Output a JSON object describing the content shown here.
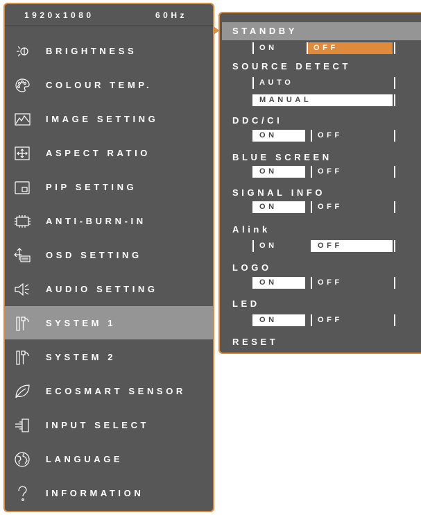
{
  "left_menu": {
    "resolution": "1920x1080",
    "refresh": "60Hz",
    "items": [
      {
        "label": "BRIGHTNESS",
        "icon": "brightness-icon"
      },
      {
        "label": "COLOUR TEMP.",
        "icon": "palette-icon"
      },
      {
        "label": "IMAGE SETTING",
        "icon": "image-icon"
      },
      {
        "label": "ASPECT RATIO",
        "icon": "aspect-ratio-icon"
      },
      {
        "label": "PIP SETTING",
        "icon": "pip-icon"
      },
      {
        "label": "ANTI-BURN-IN",
        "icon": "chip-icon"
      },
      {
        "label": "OSD SETTING",
        "icon": "osd-icon"
      },
      {
        "label": "AUDIO SETTING",
        "icon": "speaker-icon"
      },
      {
        "label": "SYSTEM 1",
        "icon": "tools-icon",
        "selected": true
      },
      {
        "label": "SYSTEM 2",
        "icon": "tools-icon"
      },
      {
        "label": "ECOSMART SENSOR",
        "icon": "leaf-icon"
      },
      {
        "label": "INPUT SELECT",
        "icon": "input-icon"
      },
      {
        "label": "LANGUAGE",
        "icon": "globe-icon"
      },
      {
        "label": "INFORMATION",
        "icon": "question-icon"
      }
    ]
  },
  "right_menu": {
    "standby": {
      "label": "STANDBY",
      "on": "ON",
      "off": "OFF",
      "value": "OFF"
    },
    "source_detect": {
      "label": "SOURCE DETECT",
      "auto": "AUTO",
      "manual": "MANUAL",
      "value": "MANUAL"
    },
    "ddc_ci": {
      "label": "DDC/CI",
      "on": "ON",
      "off": "OFF",
      "value": "ON"
    },
    "blue_screen": {
      "label": "BLUE SCREEN",
      "on": "ON",
      "off": "OFF",
      "value": "ON"
    },
    "signal_info": {
      "label": "SIGNAL INFO",
      "on": "ON",
      "off": "OFF",
      "value": "ON"
    },
    "alink": {
      "label": "Alink",
      "on": "ON",
      "off": "OFF",
      "value": "OFF"
    },
    "logo": {
      "label": "LOGO",
      "on": "ON",
      "off": "OFF",
      "value": "ON"
    },
    "led": {
      "label": "LED",
      "on": "ON",
      "off": "OFF",
      "value": "ON"
    },
    "reset": {
      "label": "RESET"
    }
  },
  "colors": {
    "panel": "#575757",
    "accent": "#e08a3c",
    "highlight": "#959595",
    "selected_option": "#ffffff"
  }
}
